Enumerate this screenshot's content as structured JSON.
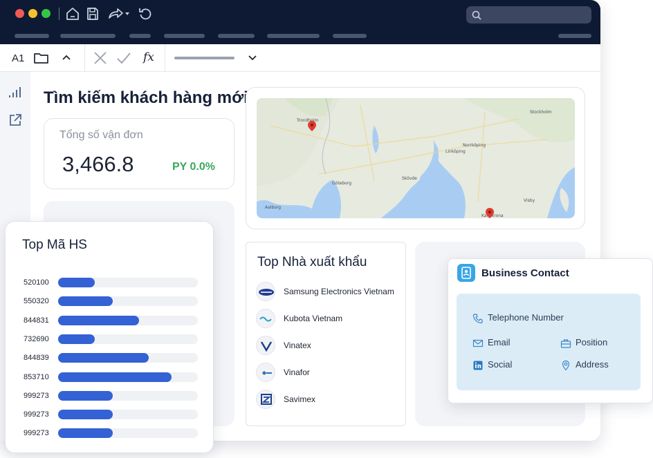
{
  "formula_bar": {
    "cell_ref": "A1",
    "fx_label": "fx"
  },
  "page": {
    "title": "Tìm kiếm khách hàng mới"
  },
  "kpi": {
    "label": "Tổng số vận đơn",
    "value": "3,466.8",
    "delta": "PY 0.0%",
    "delta_color": "#3aa85a"
  },
  "exporters": {
    "title": "Top Nhà xuất khẩu",
    "items": [
      {
        "name": "Samsung Electronics Vietnam",
        "logo": "samsung-logo"
      },
      {
        "name": "Kubota Vietnam",
        "logo": "kubota-logo"
      },
      {
        "name": "Vinatex",
        "logo": "vinatex-logo"
      },
      {
        "name": "Vinafor",
        "logo": "vinafor-logo"
      },
      {
        "name": "Savimex",
        "logo": "savimex-logo"
      }
    ]
  },
  "top_hs": {
    "title": "Top Mã HS",
    "bar_color": "#3461d4",
    "rows": [
      {
        "code": "520100",
        "fill": 0.26
      },
      {
        "code": "550320",
        "fill": 0.39
      },
      {
        "code": "844831",
        "fill": 0.58
      },
      {
        "code": "732690",
        "fill": 0.26
      },
      {
        "code": "844839",
        "fill": 0.65
      },
      {
        "code": "853710",
        "fill": 0.81
      },
      {
        "code": "999273",
        "fill": 0.39
      },
      {
        "code": "999273",
        "fill": 0.39
      },
      {
        "code": "999273",
        "fill": 0.39
      }
    ]
  },
  "business_contact": {
    "title": "Business Contact",
    "fields": {
      "telephone": "Telephone Number",
      "email": "Email",
      "position": "Position",
      "social": "Social",
      "address": "Address"
    }
  },
  "map": {
    "labels": [
      "Trondheim",
      "Stockholm",
      "Norrköping",
      "Linköping",
      "Göteborg",
      "Aalborg",
      "Skövde",
      "Karlskrona",
      "Visby"
    ],
    "markers": 2
  },
  "colors": {
    "titlebar": "#0e1a33",
    "accent": "#3461d4"
  }
}
